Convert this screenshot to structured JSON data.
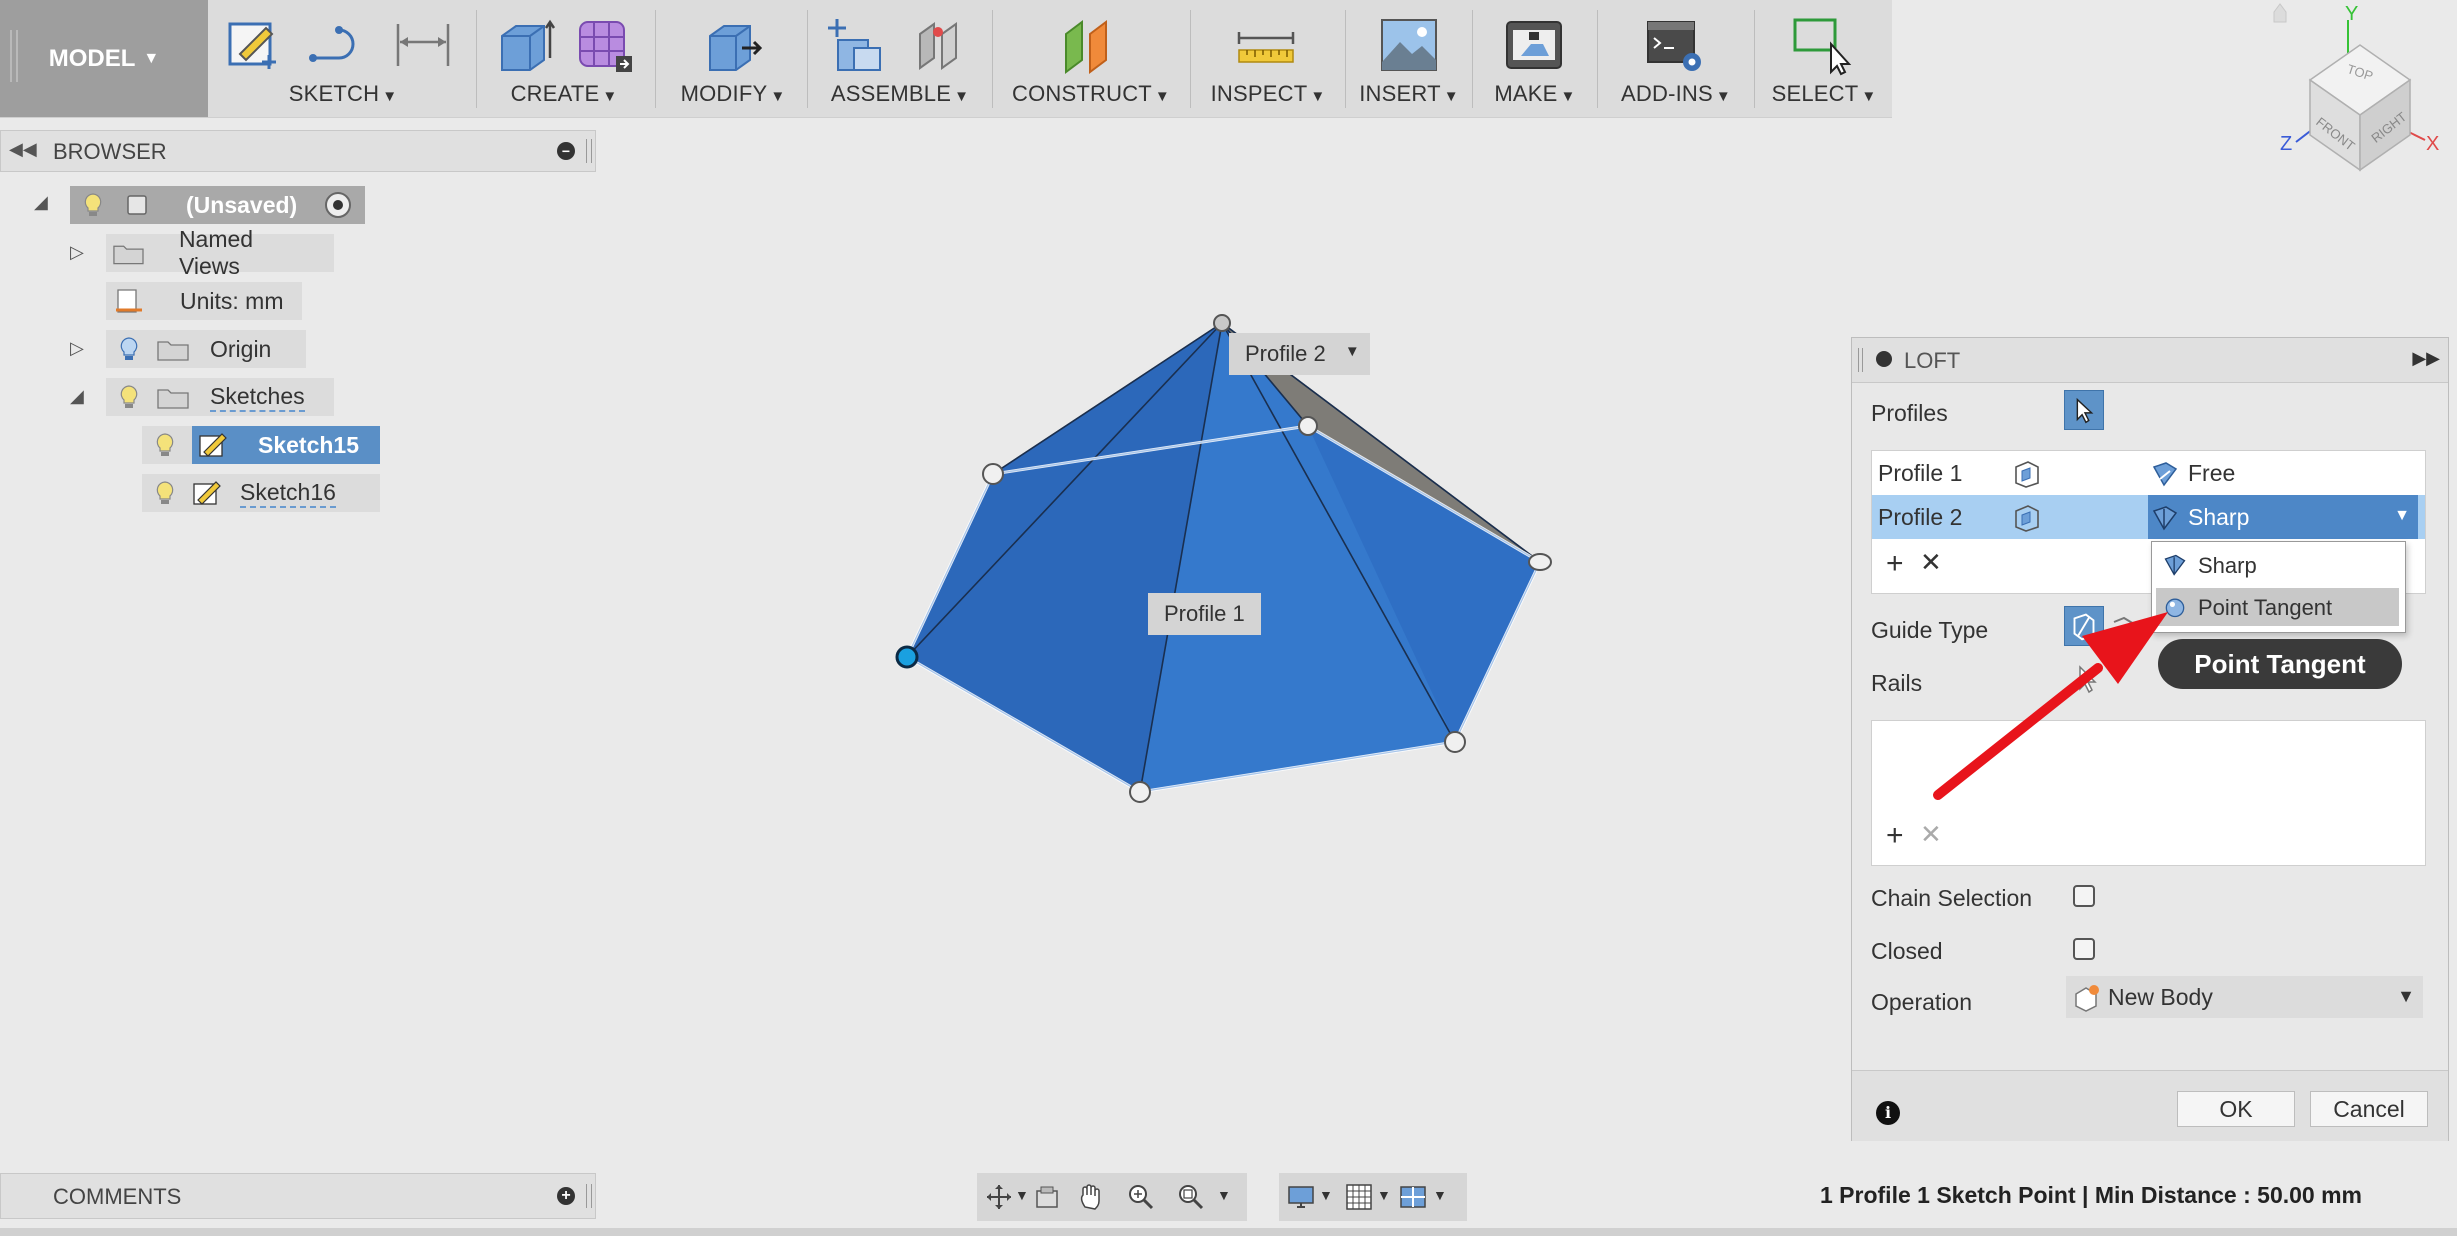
{
  "toolbar": {
    "workspace": "MODEL",
    "groups": [
      {
        "label": "SKETCH"
      },
      {
        "label": "CREATE"
      },
      {
        "label": "MODIFY"
      },
      {
        "label": "ASSEMBLE"
      },
      {
        "label": "CONSTRUCT"
      },
      {
        "label": "INSPECT"
      },
      {
        "label": "INSERT"
      },
      {
        "label": "MAKE"
      },
      {
        "label": "ADD-INS"
      },
      {
        "label": "SELECT"
      }
    ]
  },
  "browser": {
    "title": "BROWSER",
    "root": "(Unsaved)",
    "items": [
      {
        "label": "Named Views"
      },
      {
        "label": "Units: mm"
      },
      {
        "label": "Origin"
      },
      {
        "label": "Sketches"
      },
      {
        "label": "Sketch15"
      },
      {
        "label": "Sketch16"
      }
    ]
  },
  "viewport": {
    "profile1_label": "Profile 1",
    "profile2_label": "Profile 2"
  },
  "viewcube": {
    "top": "TOP",
    "front": "FRONT",
    "right": "RIGHT",
    "axis_x": "X",
    "axis_y": "Y",
    "axis_z": "Z"
  },
  "loft": {
    "title": "LOFT",
    "profiles_label": "Profiles",
    "profiles": [
      {
        "name": "Profile 1",
        "condition": "Free"
      },
      {
        "name": "Profile 2",
        "condition": "Sharp"
      }
    ],
    "condition_options": [
      "Sharp",
      "Point Tangent"
    ],
    "tooltip": "Point Tangent",
    "guide_type_label": "Guide Type",
    "rails_label": "Rails",
    "chain_selection_label": "Chain Selection",
    "closed_label": "Closed",
    "operation_label": "Operation",
    "operation_value": "New Body",
    "ok": "OK",
    "cancel": "Cancel"
  },
  "comments": {
    "title": "COMMENTS"
  },
  "status": "1 Profile 1 Sketch Point | Min Distance : 50.00 mm",
  "colors": {
    "selection_blue": "#5a8fc6",
    "body_blue": "#2f6fc4",
    "annotation_red": "#e8141b"
  }
}
